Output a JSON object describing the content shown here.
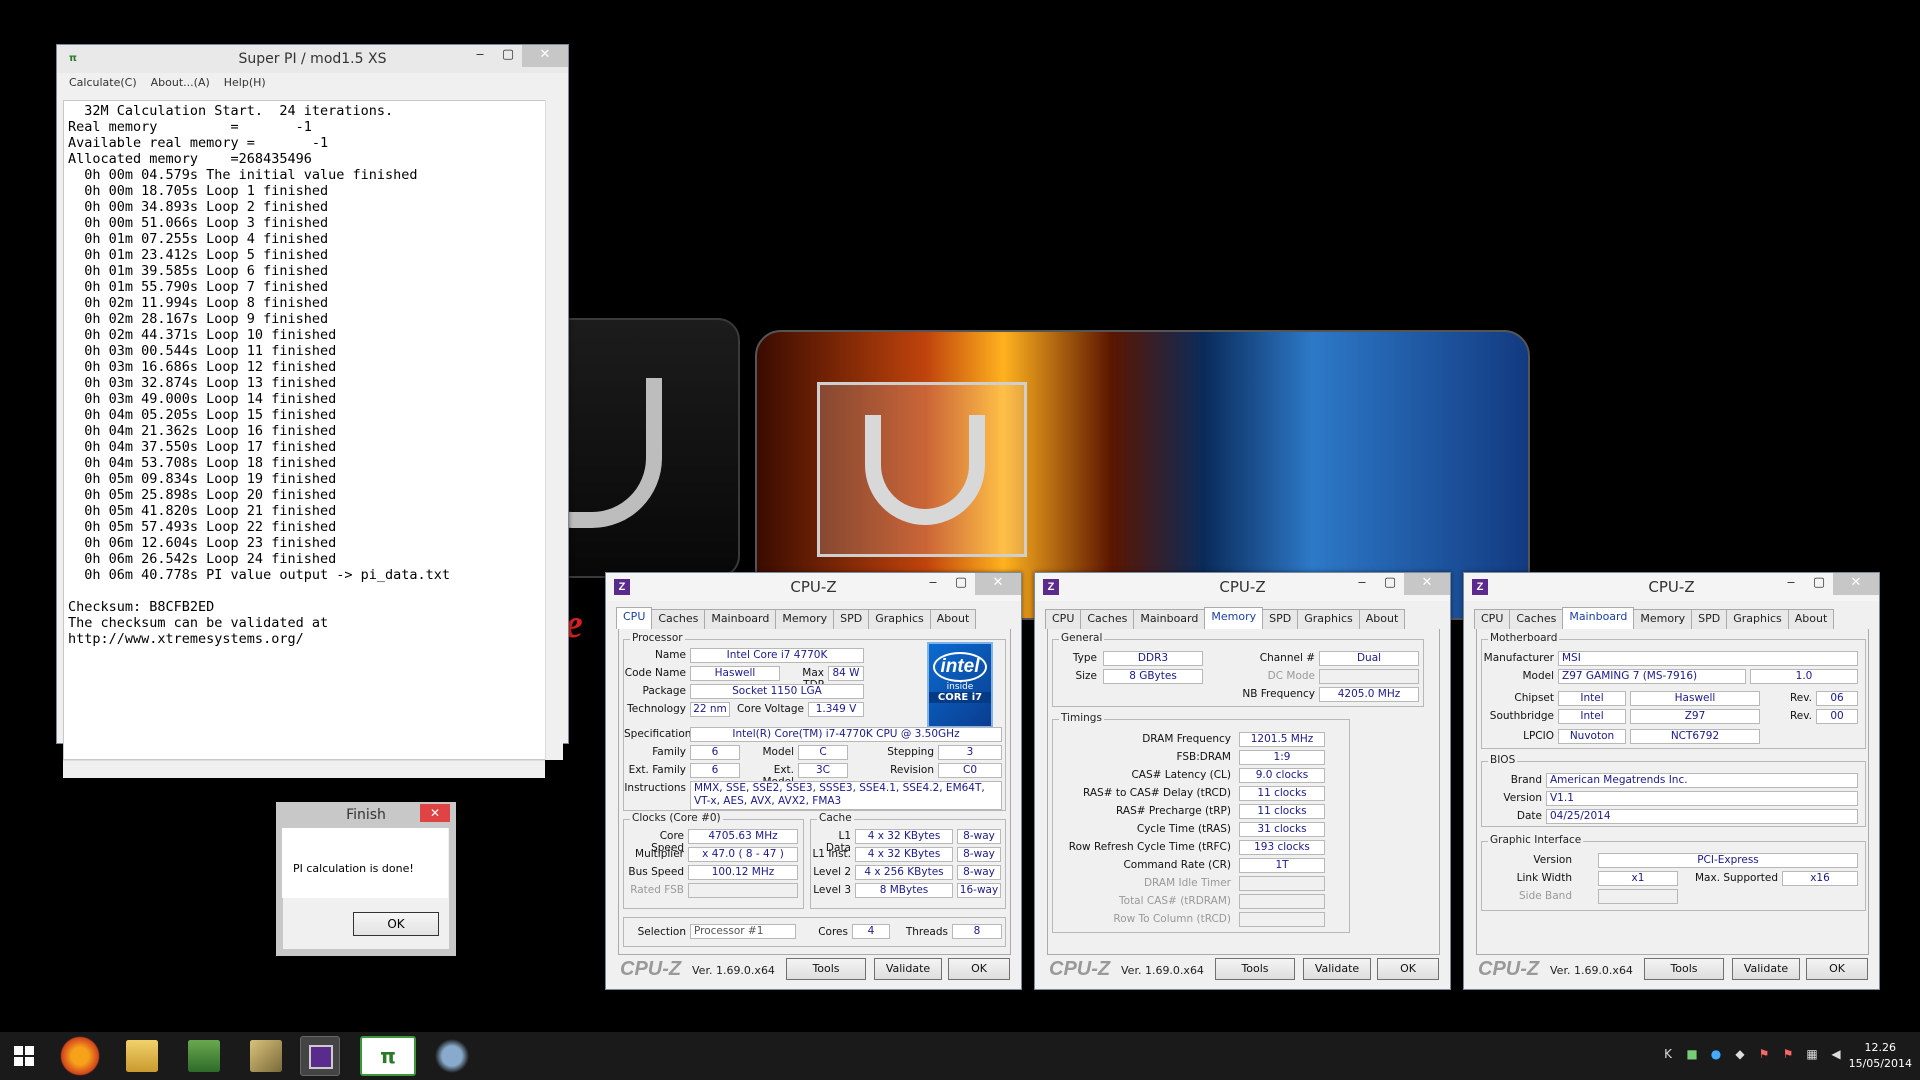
{
  "superpi": {
    "title": "Super PI / mod1.5 XS",
    "menu": [
      "Calculate(C)",
      "About...(A)",
      "Help(H)"
    ],
    "output": "  32M Calculation Start.  24 iterations.\nReal memory         =       -1\nAvailable real memory =       -1\nAllocated memory    =268435496\n  0h 00m 04.579s The initial value finished\n  0h 00m 18.705s Loop 1 finished\n  0h 00m 34.893s Loop 2 finished\n  0h 00m 51.066s Loop 3 finished\n  0h 01m 07.255s Loop 4 finished\n  0h 01m 23.412s Loop 5 finished\n  0h 01m 39.585s Loop 6 finished\n  0h 01m 55.790s Loop 7 finished\n  0h 02m 11.994s Loop 8 finished\n  0h 02m 28.167s Loop 9 finished\n  0h 02m 44.371s Loop 10 finished\n  0h 03m 00.544s Loop 11 finished\n  0h 03m 16.686s Loop 12 finished\n  0h 03m 32.874s Loop 13 finished\n  0h 03m 49.000s Loop 14 finished\n  0h 04m 05.205s Loop 15 finished\n  0h 04m 21.362s Loop 16 finished\n  0h 04m 37.550s Loop 17 finished\n  0h 04m 53.708s Loop 18 finished\n  0h 05m 09.834s Loop 19 finished\n  0h 05m 25.898s Loop 20 finished\n  0h 05m 41.820s Loop 21 finished\n  0h 05m 57.493s Loop 22 finished\n  0h 06m 12.604s Loop 23 finished\n  0h 06m 26.542s Loop 24 finished\n  0h 06m 40.778s PI value output -> pi_data.txt\n\nChecksum: B8CFB2ED\nThe checksum can be validated at\nhttp://www.xtremesystems.org/"
  },
  "finish": {
    "title": "Finish",
    "message": "PI calculation is done!",
    "ok": "OK",
    "close": "✕"
  },
  "cpuz_common": {
    "title": "CPU-Z",
    "brand": "CPU-Z",
    "version": "Ver. 1.69.0.x64",
    "tools": "Tools",
    "validate": "Validate",
    "ok": "OK",
    "tabs": [
      "CPU",
      "Caches",
      "Mainboard",
      "Memory",
      "SPD",
      "Graphics",
      "About"
    ]
  },
  "cpu": {
    "processor": "Processor",
    "name_l": "Name",
    "name": "Intel Core i7 4770K",
    "codename_l": "Code Name",
    "codename": "Haswell",
    "maxtdp_l": "Max TDP",
    "maxtdp": "84 W",
    "package_l": "Package",
    "package": "Socket 1150 LGA",
    "tech_l": "Technology",
    "tech": "22 nm",
    "cv_l": "Core Voltage",
    "cv": "1.349 V",
    "spec_l": "Specification",
    "spec": "Intel(R) Core(TM) i7-4770K CPU @ 3.50GHz",
    "family_l": "Family",
    "family": "6",
    "model_l": "Model",
    "model": "C",
    "stepping_l": "Stepping",
    "stepping": "3",
    "extfam_l": "Ext. Family",
    "extfam": "6",
    "extmodel_l": "Ext. Model",
    "extmodel": "3C",
    "revision_l": "Revision",
    "revision": "C0",
    "instr_l": "Instructions",
    "instr": "MMX, SSE, SSE2, SSE3, SSSE3, SSE4.1, SSE4.2, EM64T,",
    "instr2": "VT-x, AES, AVX, AVX2, FMA3",
    "intel_brand": "intel",
    "intel_inside": "inside",
    "intel_core": "CORE i7",
    "clocks": "Clocks (Core #0)",
    "cs_l": "Core Speed",
    "cs": "4705.63 MHz",
    "mult_l": "Multiplier",
    "mult": "x 47.0 ( 8 - 47 )",
    "bus_l": "Bus Speed",
    "bus": "100.12 MHz",
    "rfsb_l": "Rated FSB",
    "cache": "Cache",
    "l1d_l": "L1 Data",
    "l1d": "4 x 32 KBytes",
    "l1d_w": "8-way",
    "l1i_l": "L1 Inst.",
    "l1i": "4 x 32 KBytes",
    "l1i_w": "8-way",
    "l2_l": "Level 2",
    "l2": "4 x 256 KBytes",
    "l2_w": "8-way",
    "l3_l": "Level 3",
    "l3": "8 MBytes",
    "l3_w": "16-way",
    "sel_l": "Selection",
    "sel": "Processor #1",
    "cores_l": "Cores",
    "cores": "4",
    "threads_l": "Threads",
    "threads": "8"
  },
  "mem": {
    "general": "General",
    "type_l": "Type",
    "type": "DDR3",
    "chan_l": "Channel #",
    "chan": "Dual",
    "size_l": "Size",
    "size": "8 GBytes",
    "dc_l": "DC Mode",
    "nb_l": "NB Frequency",
    "nb": "4205.0 MHz",
    "timings": "Timings",
    "rows": [
      [
        "DRAM Frequency",
        "1201.5 MHz"
      ],
      [
        "FSB:DRAM",
        "1:9"
      ],
      [
        "CAS# Latency (CL)",
        "9.0 clocks"
      ],
      [
        "RAS# to CAS# Delay (tRCD)",
        "11 clocks"
      ],
      [
        "RAS# Precharge (tRP)",
        "11 clocks"
      ],
      [
        "Cycle Time (tRAS)",
        "31 clocks"
      ],
      [
        "Row Refresh Cycle Time (tRFC)",
        "193 clocks"
      ],
      [
        "Command Rate (CR)",
        "1T"
      ],
      [
        "DRAM Idle Timer",
        ""
      ],
      [
        "Total CAS# (tRDRAM)",
        ""
      ],
      [
        "Row To Column (tRCD)",
        ""
      ]
    ]
  },
  "mb": {
    "motherboard": "Motherboard",
    "manu_l": "Manufacturer",
    "manu": "MSI",
    "model_l": "Model",
    "model": "Z97 GAMING 7 (MS-7916)",
    "model_rev": "1.0",
    "chipset_l": "Chipset",
    "chipset": "Intel",
    "chipset2": "Haswell",
    "rev_l": "Rev.",
    "chipset_rev": "06",
    "sb_l": "Southbridge",
    "sb": "Intel",
    "sb2": "Z97",
    "sb_rev": "00",
    "lpcio_l": "LPCIO",
    "lpcio": "Nuvoton",
    "lpcio2": "NCT6792",
    "bios": "BIOS",
    "brand_l": "Brand",
    "brand": "American Megatrends Inc.",
    "ver_l": "Version",
    "ver": "V1.1",
    "date_l": "Date",
    "date": "04/25/2014",
    "gi": "Graphic Interface",
    "giver_l": "Version",
    "giver": "PCI-Express",
    "lw_l": "Link Width",
    "lw": "x1",
    "ms_l": "Max. Supported",
    "ms": "x16",
    "sbd_l": "Side Band"
  },
  "clock": {
    "time": "12.26",
    "date": "15/05/2014"
  },
  "colors": {
    "accent": "#1a3fa6",
    "value_text": "#1a1a8c",
    "close_red": "#e04343"
  }
}
